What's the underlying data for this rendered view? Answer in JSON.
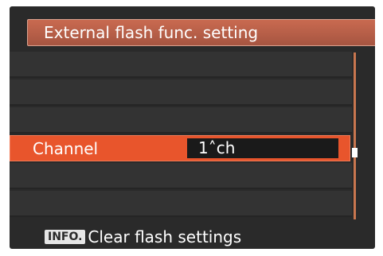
{
  "header": {
    "title": "External flash func. setting"
  },
  "menu": {
    "selected_item": {
      "label": "Channel",
      "value": "1˄ch"
    }
  },
  "footer": {
    "info_button_label": "INFO.",
    "hint_text": "Clear flash settings"
  },
  "colors": {
    "accent": "#e8552c",
    "title_bar": "#b55c46",
    "background": "#2a2a2a"
  }
}
